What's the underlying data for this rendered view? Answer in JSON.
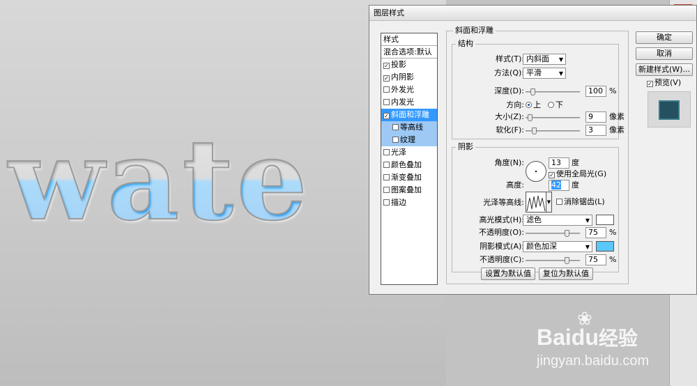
{
  "canvas": {
    "text": "wate"
  },
  "dialog": {
    "title": "图层样式",
    "styles_header": "样式",
    "blend_options": "混合选项:默认",
    "style_items": [
      {
        "label": "投影",
        "checked": true
      },
      {
        "label": "内阴影",
        "checked": true
      },
      {
        "label": "外发光",
        "checked": false
      },
      {
        "label": "内发光",
        "checked": false
      },
      {
        "label": "斜面和浮雕",
        "checked": true
      },
      {
        "label": "等高线",
        "checked": false
      },
      {
        "label": "纹理",
        "checked": false
      },
      {
        "label": "光泽",
        "checked": false
      },
      {
        "label": "颜色叠加",
        "checked": false
      },
      {
        "label": "渐变叠加",
        "checked": false
      },
      {
        "label": "图案叠加",
        "checked": false
      },
      {
        "label": "描边",
        "checked": false
      }
    ],
    "section_title": "斜面和浮雕",
    "structure": {
      "title": "结构",
      "style_label": "样式(T):",
      "style_value": "内斜面",
      "method_label": "方法(Q):",
      "method_value": "平滑",
      "depth_label": "深度(D):",
      "depth_value": "100",
      "depth_unit": "%",
      "depth_fraction": 0.1,
      "direction_label": "方向:",
      "dir_up": "上",
      "dir_down": "下",
      "size_label": "大小(Z):",
      "size_value": "9",
      "size_unit": "像素",
      "size_fraction": 0.04,
      "soften_label": "软化(F):",
      "soften_value": "3",
      "soften_unit": "像素",
      "soften_fraction": 0.12
    },
    "shading": {
      "title": "阴影",
      "angle_label": "角度(N):",
      "angle_value": "13",
      "angle_unit": "度",
      "global_light": "使用全局光(G)",
      "global_light_checked": true,
      "altitude_label": "高度:",
      "altitude_value": "42",
      "altitude_unit": "度",
      "gloss_label": "光泽等高线:",
      "anti_alias": "消除锯齿(L)",
      "highlight_label": "高光模式(H):",
      "highlight_value": "滤色",
      "highlight_color": "#ffffff",
      "opacity1_label": "不透明度(O):",
      "opacity1_value": "75",
      "opacity1_unit": "%",
      "shadow_label": "阴影模式(A):",
      "shadow_value": "颜色加深",
      "shadow_color": "#5ac8fa",
      "opacity2_label": "不透明度(C):",
      "opacity2_value": "75",
      "opacity2_unit": "%"
    },
    "btn_set_default": "设置为默认值",
    "btn_reset_default": "复位为默认值",
    "btn_ok": "确定",
    "btn_cancel": "取消",
    "btn_new_style": "新建样式(W)...",
    "preview_label": "预览(V)",
    "preview_checked": true
  },
  "watermark": {
    "brand": "Bai",
    "brand2": "经验",
    "url": "jingyan.baidu.com"
  }
}
